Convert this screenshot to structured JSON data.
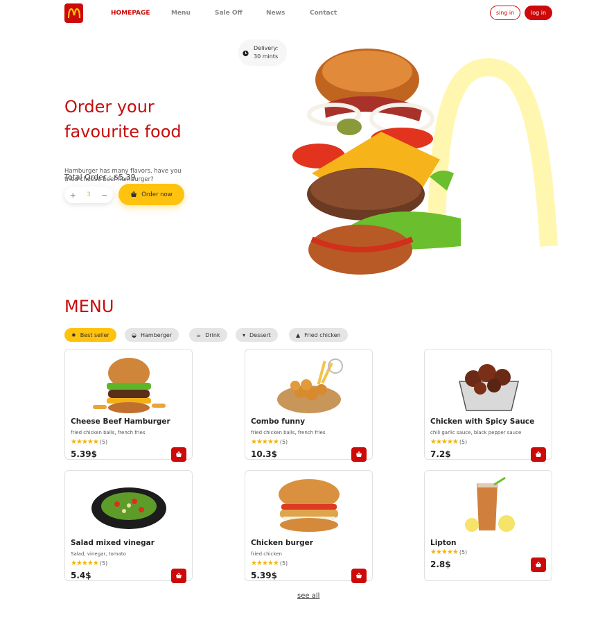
{
  "header": {
    "nav": [
      "HOMEPAGE",
      "Menu",
      "Sale Off",
      "News",
      "Contact"
    ],
    "sign_in": "sing in",
    "log_in": "log in"
  },
  "hero": {
    "title": "Order your favourite food",
    "description": "Hamburger has many flavors, have you tried cheese beef hamburger?",
    "total_label": "Total Order : $5.39",
    "quantity": "3",
    "order_button": "Order now",
    "delivery_line1": "Delivery:",
    "delivery_line2": "30 mints"
  },
  "menu": {
    "title": "MENU",
    "categories": [
      "Best seller",
      "Hamberger",
      "Drink",
      "Dessert",
      "Fried chicken"
    ],
    "items": [
      {
        "name": "Cheese Beef Hamburger",
        "desc": "fried chicken balls, french fries",
        "stars": "★★★★★",
        "rating": "(5)",
        "price": "5.39$"
      },
      {
        "name": "Combo funny",
        "desc": "fried chicken balls, french fries",
        "stars": "★★★★★",
        "rating": "(5)",
        "price": "10.3$"
      },
      {
        "name": "Chicken with Spicy Sauce",
        "desc": "chili garlic sauce, black pepper sauce",
        "stars": "★★★★★",
        "rating": "(5)",
        "price": "7.2$"
      },
      {
        "name": "Salad mixed vinegar",
        "desc": "Salad, vinegar, tomato",
        "stars": "★★★★★",
        "rating": "(5)",
        "price": "5.4$"
      },
      {
        "name": "Chicken burger",
        "desc": "fried chicken",
        "stars": "★★★★★",
        "rating": "(5)",
        "price": "5.39$"
      },
      {
        "name": "Lipton",
        "desc": "",
        "stars": "★★★★★",
        "rating": "(5)",
        "price": "2.8$"
      }
    ],
    "see_all": "see all"
  },
  "colors": {
    "brand_red": "#cc0a0a",
    "accent_yellow": "#ffc20e"
  }
}
